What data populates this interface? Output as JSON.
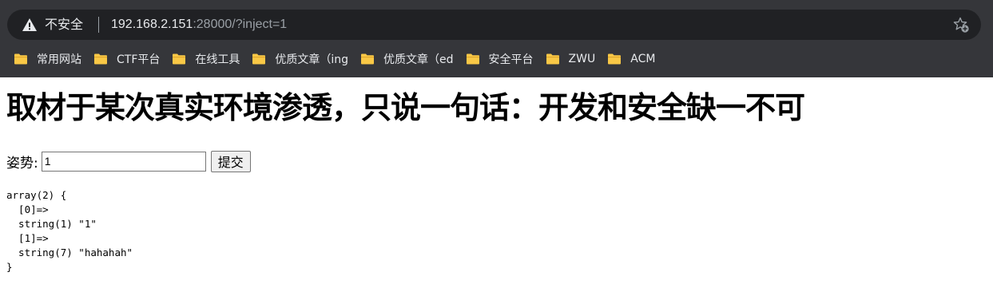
{
  "browser": {
    "security_label": "不安全",
    "url_host": "192.168.2.151",
    "url_rest": ":28000/?inject=1",
    "bookmarks": [
      {
        "label": "常用网站"
      },
      {
        "label": "CTF平台"
      },
      {
        "label": "在线工具"
      },
      {
        "label": "优质文章（ing"
      },
      {
        "label": "优质文章（ed"
      },
      {
        "label": "安全平台"
      },
      {
        "label": "ZWU"
      },
      {
        "label": "ACM"
      }
    ]
  },
  "page": {
    "heading": "取材于某次真实环境渗透，只说一句话：开发和安全缺一不可",
    "form_label": "姿势:",
    "input_value": "1",
    "submit_label": "提交",
    "output": "array(2) {\n  [0]=>\n  string(1) \"1\"\n  [1]=>\n  string(7) \"hahahah\"\n}"
  }
}
